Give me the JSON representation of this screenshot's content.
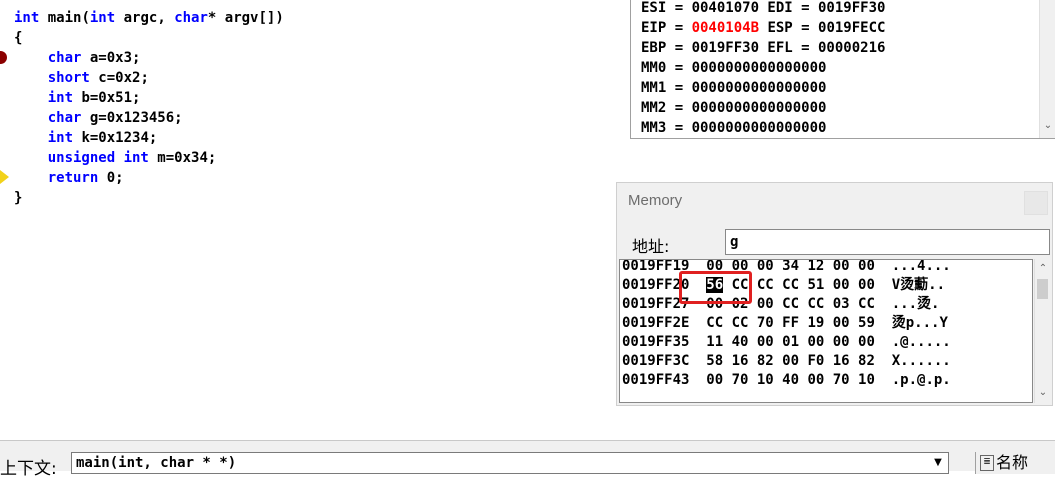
{
  "editor": {
    "lines": [
      {
        "parts": [
          {
            "t": "int",
            "kw": true
          },
          {
            "t": " main(",
            "kw": false
          },
          {
            "t": "int",
            "kw": true
          },
          {
            "t": " argc, ",
            "kw": false
          },
          {
            "t": "char",
            "kw": true
          },
          {
            "t": "* argv[])",
            "kw": false
          }
        ]
      },
      {
        "parts": [
          {
            "t": "{",
            "kw": false
          }
        ]
      },
      {
        "parts": [
          {
            "t": "    ",
            "kw": false
          },
          {
            "t": "char",
            "kw": true
          },
          {
            "t": " a=0x3;",
            "kw": false
          }
        ]
      },
      {
        "parts": [
          {
            "t": "    ",
            "kw": false
          },
          {
            "t": "short",
            "kw": true
          },
          {
            "t": " c=0x2;",
            "kw": false
          }
        ]
      },
      {
        "parts": [
          {
            "t": "    ",
            "kw": false
          },
          {
            "t": "int",
            "kw": true
          },
          {
            "t": " b=0x51;",
            "kw": false
          }
        ]
      },
      {
        "parts": [
          {
            "t": "    ",
            "kw": false
          },
          {
            "t": "char",
            "kw": true
          },
          {
            "t": " g=0x123456;",
            "kw": false
          }
        ]
      },
      {
        "parts": [
          {
            "t": "    ",
            "kw": false
          },
          {
            "t": "int",
            "kw": true
          },
          {
            "t": " k=0x1234;",
            "kw": false
          }
        ]
      },
      {
        "parts": [
          {
            "t": "    ",
            "kw": false
          },
          {
            "t": "unsigned int",
            "kw": true
          },
          {
            "t": " m=0x34;",
            "kw": false
          }
        ]
      },
      {
        "parts": [
          {
            "t": "    ",
            "kw": false
          },
          {
            "t": "return",
            "kw": true
          },
          {
            "t": " 0;",
            "kw": false
          }
        ]
      },
      {
        "parts": [
          {
            "t": "}",
            "kw": false
          }
        ]
      }
    ],
    "colors": {
      "keyword": "#0000ff",
      "breakpoint": "#8b0000",
      "current_line_arrow": "#f2d21a"
    }
  },
  "registers": {
    "lines": [
      [
        {
          "t": "ESI = 00401070 EDI = 0019FF30",
          "changed": false
        }
      ],
      [
        {
          "t": "EIP = ",
          "changed": false
        },
        {
          "t": "0040104B",
          "changed": true
        },
        {
          "t": " ESP = 0019FECC",
          "changed": false
        }
      ],
      [
        {
          "t": "EBP = 0019FF30 EFL = 00000216",
          "changed": false
        }
      ],
      [
        {
          "t": "MM0 = 0000000000000000",
          "changed": false
        }
      ],
      [
        {
          "t": "MM1 = 0000000000000000",
          "changed": false
        }
      ],
      [
        {
          "t": "MM2 = 0000000000000000",
          "changed": false
        }
      ],
      [
        {
          "t": "MM3 = 0000000000000000",
          "changed": false
        }
      ]
    ],
    "changed_color": "#ff0000"
  },
  "memory": {
    "title": "Memory",
    "address_label": "地址:",
    "address_value": "g",
    "rows": [
      {
        "addr": "0019FF19",
        "bytes": "00 00 00 34 12 00 00",
        "ascii": "...4..."
      },
      {
        "addr": "0019FF20",
        "bytes_highlight": "56",
        "bytes_rest": " CC CC CC 51 00 00",
        "ascii": "V烫蘍.."
      },
      {
        "addr": "0019FF27",
        "bytes": "00 02 00 CC CC 03 CC",
        "ascii": "...烫."
      },
      {
        "addr": "0019FF2E",
        "bytes": "CC CC 70 FF 19 00 59",
        "ascii": "烫p...Y"
      },
      {
        "addr": "0019FF35",
        "bytes": "11 40 00 01 00 00 00",
        "ascii": ".@....."
      },
      {
        "addr": "0019FF3C",
        "bytes": "58 16 82 00 F0 16 82",
        "ascii": "X......"
      },
      {
        "addr": "0019FF43",
        "bytes": "00 70 10 40 00 70 10",
        "ascii": ".p.@.p."
      }
    ]
  },
  "context": {
    "label": "上下文:",
    "value": "main(int, char * *)",
    "name_header": "名称"
  }
}
